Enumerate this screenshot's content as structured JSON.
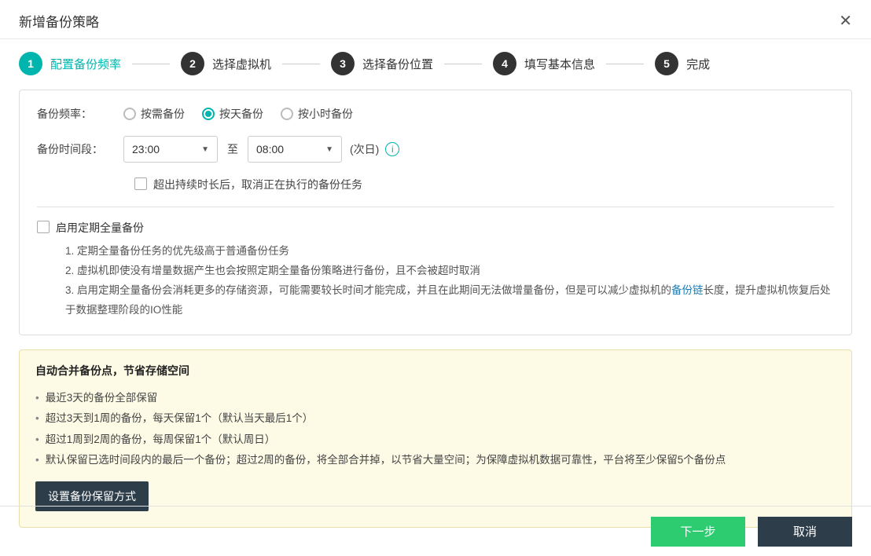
{
  "dialog": {
    "title": "新增备份策略"
  },
  "steps": [
    {
      "num": "1",
      "label": "配置备份频率",
      "active": true
    },
    {
      "num": "2",
      "label": "选择虚拟机",
      "active": false
    },
    {
      "num": "3",
      "label": "选择备份位置",
      "active": false
    },
    {
      "num": "4",
      "label": "填写基本信息",
      "active": false
    },
    {
      "num": "5",
      "label": "完成",
      "active": false
    }
  ],
  "form": {
    "freq_label": "备份频率：",
    "freq_options": {
      "ondemand": "按需备份",
      "daily": "按天备份",
      "hourly": "按小时备份"
    },
    "time_label": "备份时间段：",
    "time_start": "23:00",
    "time_sep": "至",
    "time_end": "08:00",
    "next_day": "(次日)",
    "timeout_cb": "超出持续时长后，取消正在执行的备份任务",
    "full_backup_cb": "启用定期全量备份",
    "notes": [
      "1. 定期全量备份任务的优先级高于普通备份任务",
      "2. 虚拟机即使没有增量数据产生也会按照定期全量备份策略进行备份，且不会被超时取消",
      "3. 启用定期全量备份会消耗更多的存储资源，可能需要较长时间才能完成，并且在此期间无法做增量备份，但是可以减少虚拟机的",
      "备份链",
      "长度，提升虚拟机恢复后处于数据整理阶段的IO性能"
    ]
  },
  "info": {
    "title": "自动合并备份点，节省存储空间",
    "items": [
      "最近3天的备份全部保留",
      "超过3天到1周的备份，每天保留1个（默认当天最后1个）",
      "超过1周到2周的备份，每周保留1个（默认周日）",
      "默认保留已选时间段内的最后一个备份；超过2周的备份，将全部合并掉，以节省大量空间；为保障虚拟机数据可靠性，平台将至少保留5个备份点"
    ],
    "button": "设置备份保留方式"
  },
  "footer": {
    "next": "下一步",
    "cancel": "取消"
  }
}
